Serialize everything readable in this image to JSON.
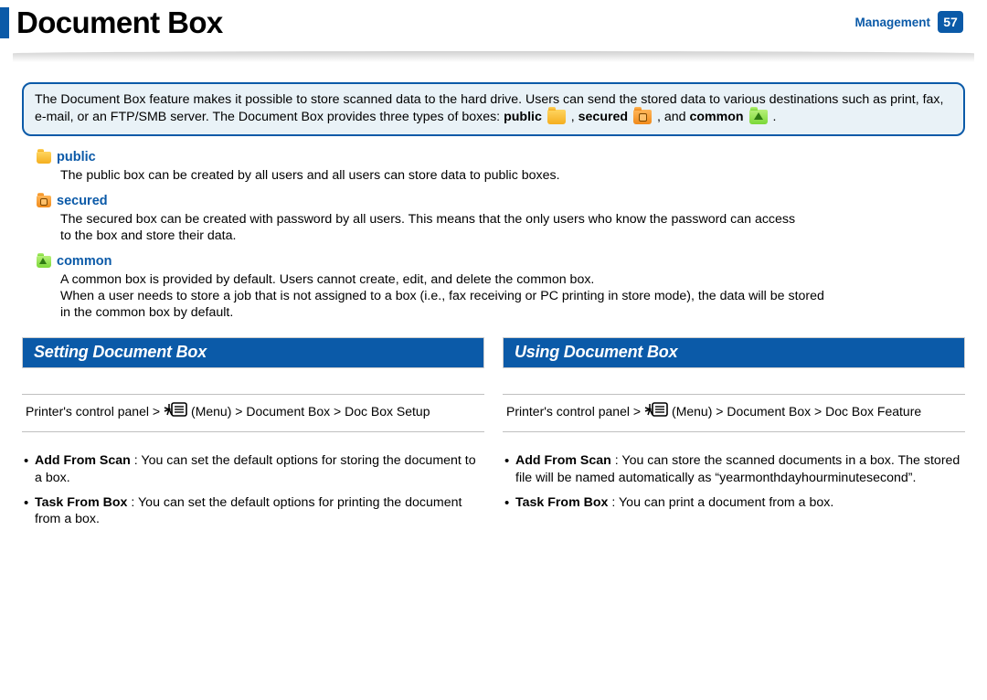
{
  "header": {
    "title": "Document Box",
    "section": "Management",
    "page": "57"
  },
  "intro": {
    "pre": "The Document Box feature makes it possible to store scanned data to the hard drive. Users can send the stored data to various destinations such as print, fax, e-mail, or an FTP/SMB server. The Document Box provides three types of boxes: ",
    "w_public": "public",
    "w_secured": "secured",
    "w_and": ", and ",
    "w_common": "common",
    "end": " ."
  },
  "types": {
    "public": {
      "label": "public",
      "body": "The public box can be created by all users and all users can store data to public boxes."
    },
    "secured": {
      "label": "secured",
      "body_l1": "The secured box can be created with password by all users. This means that the only users who know the password can access",
      "body_l2": "to the box and store their data."
    },
    "common": {
      "label": "common",
      "body_l1": "A common box is provided by default. Users cannot create, edit, and delete the common box.",
      "body_l2": "When a user needs to store a job that is not assigned to a box (i.e., fax receiving or PC printing in store mode), the data will be stored",
      "body_l3": "in the common box by default."
    }
  },
  "left": {
    "heading": "Setting Document Box",
    "path_pre": "Printer's control panel > ",
    "path_post": " (Menu) > Document Box > Doc Box Setup",
    "b1_label": "Add From Scan",
    "b1_body": " : You can set the default options for storing the document to a box.",
    "b2_label": "Task From Box",
    "b2_body": " : You can set the default options for printing the document from a box."
  },
  "right": {
    "heading": "Using Document Box",
    "path_pre": "Printer's control panel > ",
    "path_post": " (Menu) > Document Box > Doc Box Feature",
    "b1_label": "Add From Scan",
    "b1_body": " : You can store the scanned documents in a box. The stored file will be named automatically as “yearmonthdayhourminutesecond”.",
    "b2_label": "Task From Box",
    "b2_body": " : You can print a document from a box."
  }
}
